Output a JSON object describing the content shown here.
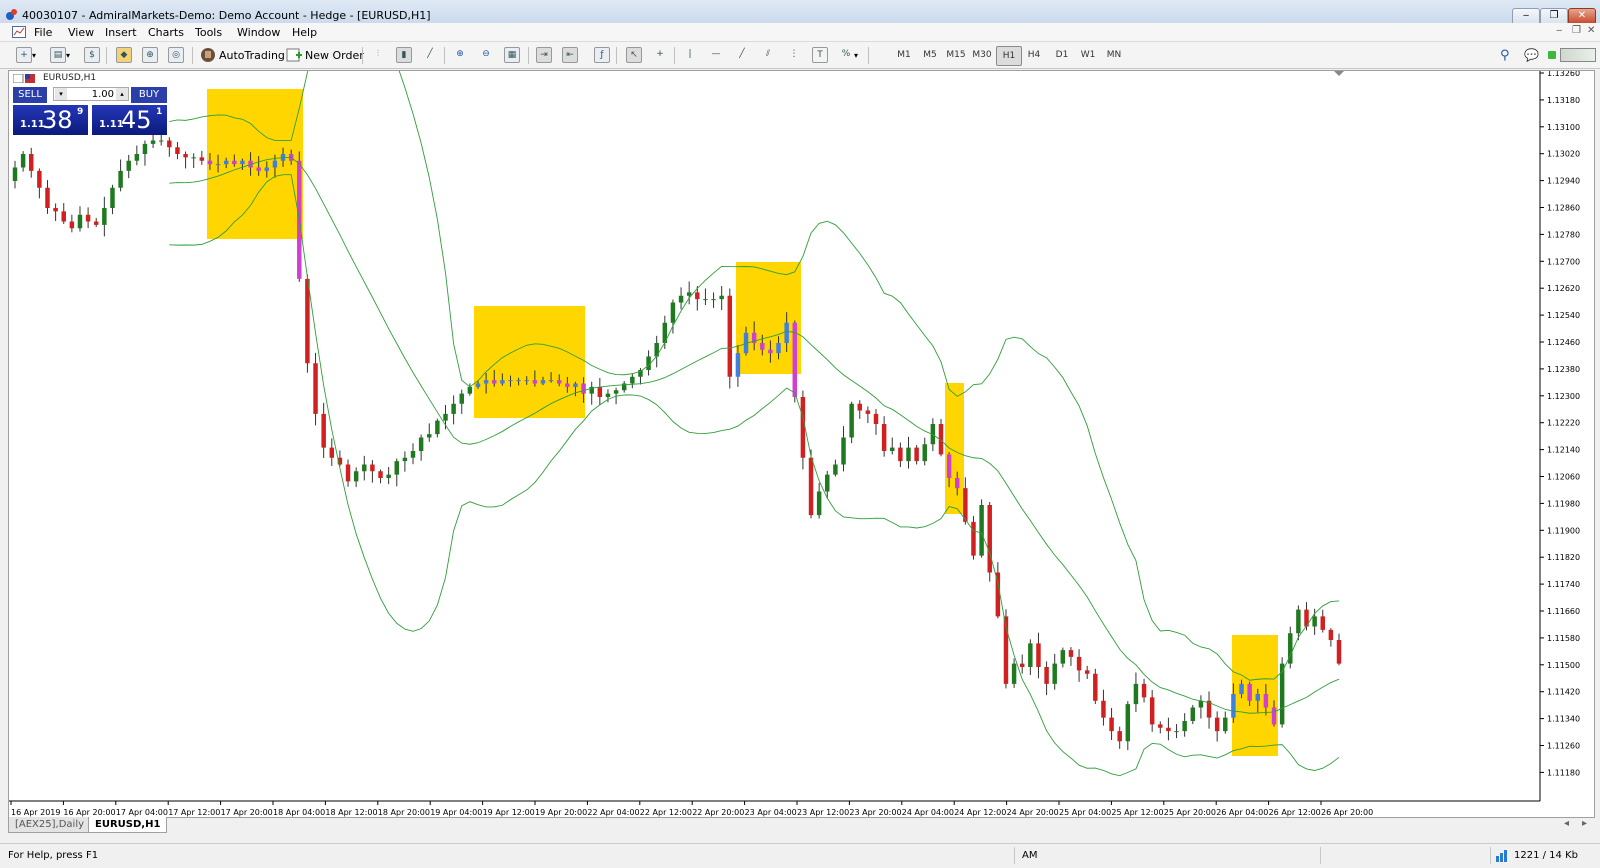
{
  "window": {
    "title": "40030107 - AdmiralMarkets-Demo: Demo Account - Hedge - [EURUSD,H1]",
    "minimize_label": "‒",
    "restore_label": "❐",
    "close_label": "✕"
  },
  "menu": [
    "File",
    "View",
    "Insert",
    "Charts",
    "Tools",
    "Window",
    "Help"
  ],
  "toolbar": {
    "autotrading_label": "AutoTrading",
    "new_order_label": "New Order",
    "timeframes": [
      "M1",
      "M5",
      "M15",
      "M30",
      "H1",
      "H4",
      "D1",
      "W1",
      "MN"
    ],
    "active_timeframe": "H1"
  },
  "chart": {
    "symbol_label": "EURUSD,H1",
    "trade_panel": {
      "sell_label": "SELL",
      "buy_label": "BUY",
      "lot": "1.00",
      "sell_price_prefix": "1.11",
      "sell_price_big": "38",
      "sell_price_sup": "9",
      "buy_price_prefix": "1.11",
      "buy_price_big": "45",
      "buy_price_sup": "1"
    }
  },
  "chart_data": {
    "type": "candlestick",
    "price_ticks": [
      "1.13260",
      "1.13180",
      "1.13100",
      "1.13020",
      "1.12940",
      "1.12860",
      "1.12780",
      "1.12700",
      "1.12620",
      "1.12540",
      "1.12460",
      "1.12380",
      "1.12300",
      "1.12220",
      "1.12140",
      "1.12060",
      "1.11980",
      "1.11900",
      "1.11820",
      "1.11740",
      "1.11660",
      "1.11580",
      "1.11500",
      "1.11420",
      "1.11340",
      "1.11260",
      "1.11180"
    ],
    "time_ticks": [
      "16 Apr 2019",
      "16 Apr 20:00",
      "17 Apr 04:00",
      "17 Apr 12:00",
      "17 Apr 20:00",
      "18 Apr 04:00",
      "18 Apr 12:00",
      "18 Apr 20:00",
      "19 Apr 04:00",
      "19 Apr 12:00",
      "19 Apr 20:00",
      "22 Apr 04:00",
      "22 Apr 12:00",
      "22 Apr 20:00",
      "23 Apr 04:00",
      "23 Apr 12:00",
      "23 Apr 20:00",
      "24 Apr 04:00",
      "24 Apr 12:00",
      "24 Apr 20:00",
      "25 Apr 04:00",
      "25 Apr 12:00",
      "25 Apr 20:00",
      "26 Apr 04:00",
      "26 Apr 12:00",
      "26 Apr 20:00"
    ],
    "closes": [
      1.1298,
      1.1302,
      1.1297,
      1.1292,
      1.1286,
      1.1285,
      1.1282,
      1.128,
      1.1284,
      1.1282,
      1.1281,
      1.1286,
      1.1292,
      1.1297,
      1.13,
      1.1302,
      1.1305,
      1.1306,
      1.1306,
      1.1304,
      1.1302,
      1.1301,
      1.1301,
      1.13,
      1.1299,
      1.1299,
      1.13,
      1.1299,
      1.13,
      1.1298,
      1.1297,
      1.1298,
      1.13,
      1.1302,
      1.13,
      1.1265,
      1.124,
      1.1225,
      1.1215,
      1.1212,
      1.121,
      1.1205,
      1.1208,
      1.121,
      1.1208,
      1.1206,
      1.1207,
      1.1211,
      1.1212,
      1.1214,
      1.1218,
      1.1219,
      1.1223,
      1.1225,
      1.1228,
      1.1231,
      1.1233,
      1.1234,
      1.1235,
      1.1234,
      1.1235,
      1.1235,
      1.1235,
      1.1235,
      1.1234,
      1.1235,
      1.1235,
      1.1234,
      1.1233,
      1.1234,
      1.1231,
      1.1233,
      1.123,
      1.1231,
      1.1232,
      1.1234,
      1.1236,
      1.1238,
      1.1242,
      1.1246,
      1.1252,
      1.1258,
      1.126,
      1.1261,
      1.1259,
      1.1259,
      1.1259,
      1.126,
      1.1236,
      1.1243,
      1.1249,
      1.1246,
      1.1244,
      1.1243,
      1.1246,
      1.1252,
      1.123,
      1.1212,
      1.1195,
      1.1202,
      1.1207,
      1.121,
      1.1218,
      1.1228,
      1.1226,
      1.1225,
      1.1222,
      1.1214,
      1.1215,
      1.1211,
      1.1215,
      1.1211,
      1.1216,
      1.1222,
      1.1213,
      1.1206,
      1.1203,
      1.1193,
      1.1183,
      1.1198,
      1.1178,
      1.1165,
      1.1145,
      1.1151,
      1.115,
      1.1157,
      1.115,
      1.1145,
      1.1151,
      1.1155,
      1.1153,
      1.1149,
      1.1148,
      1.114,
      1.1135,
      1.1131,
      1.1128,
      1.1139,
      1.1145,
      1.1141,
      1.1133,
      1.1132,
      1.1131,
      1.1131,
      1.1134,
      1.1138,
      1.114,
      1.1135,
      1.1131,
      1.1135,
      1.1142,
      1.1145,
      1.114,
      1.1142,
      1.1138,
      1.1133,
      1.1151,
      1.116,
      1.1167,
      1.1162,
      1.1165,
      1.1161,
      1.1158,
      1.1151
    ]
  },
  "tabs": [
    "[AEX25],Daily",
    "EURUSD,H1"
  ],
  "active_tab": "EURUSD,H1",
  "status": {
    "help_text": "For Help, press F1",
    "mode": "AM",
    "traffic": "1221 / 14 Kb"
  }
}
